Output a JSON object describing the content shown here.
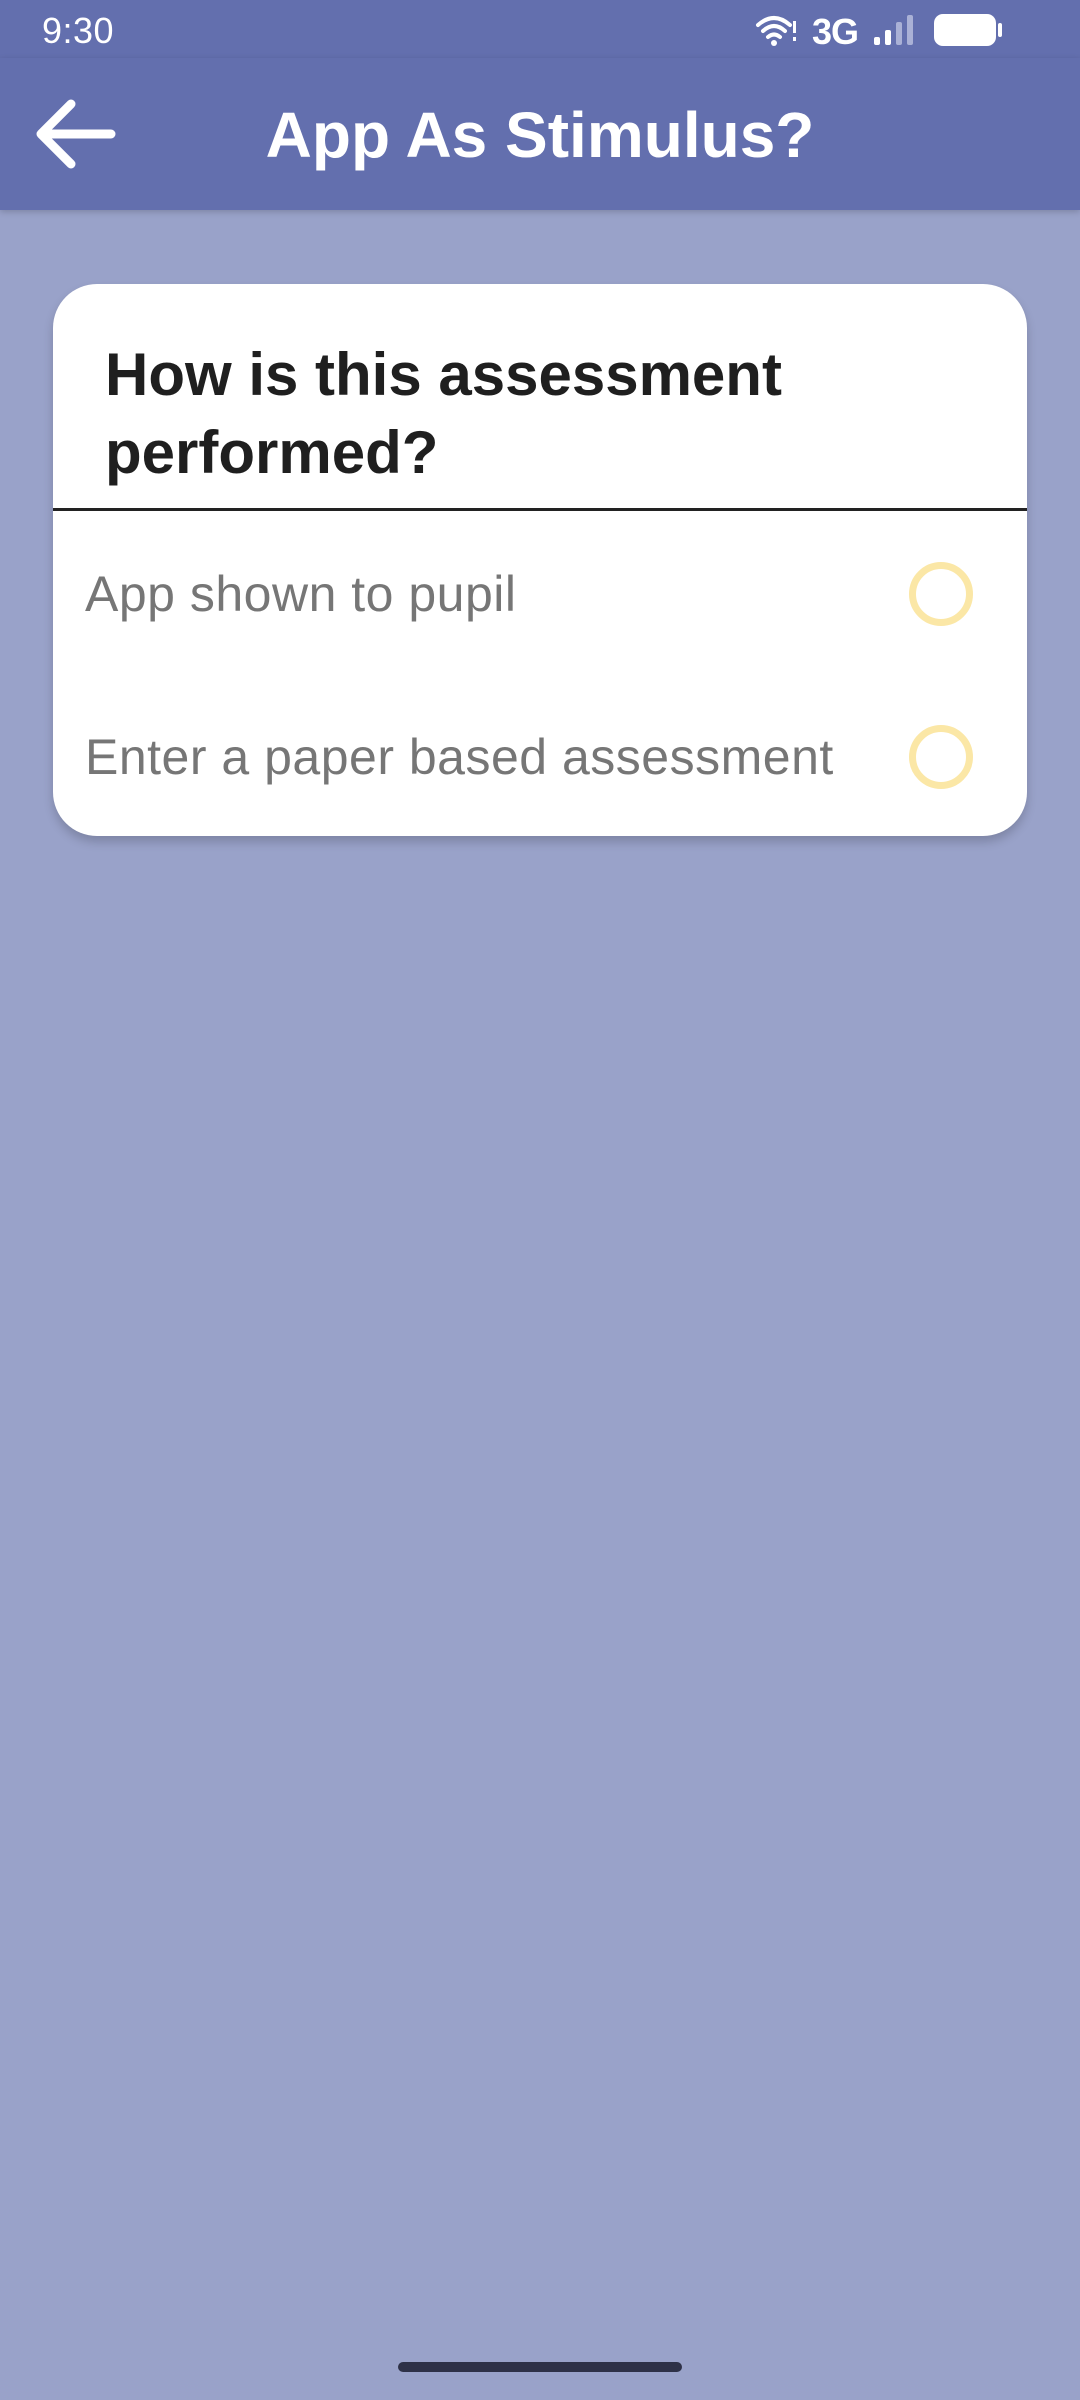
{
  "status_bar": {
    "time": "9:30",
    "network": "3G",
    "icons": [
      "wifi-icon",
      "signal-icon",
      "battery-icon"
    ]
  },
  "app_bar": {
    "title": "App As Stimulus?",
    "back_icon": "arrow-left-icon"
  },
  "card": {
    "question": "How is this assessment performed?",
    "options": [
      {
        "label": "App shown to pupil",
        "selected": false
      },
      {
        "label": "Enter a paper based assessment",
        "selected": false
      }
    ]
  },
  "colors": {
    "app_bar": "#636fae",
    "background": "#99a2c9",
    "card": "#ffffff",
    "radio_ring": "#fbe7a6",
    "option_text": "#767676"
  }
}
